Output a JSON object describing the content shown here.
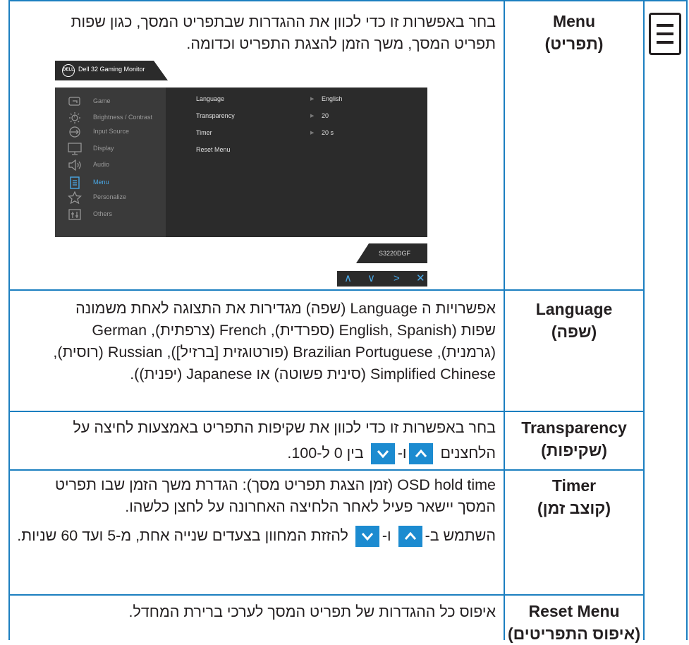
{
  "icon": "menu-icon",
  "accent_color": "#1c8bd0",
  "rows": {
    "menu": {
      "label_en": "Menu",
      "label_he": "(תפריט)",
      "desc": "בחר באפשרות זו כדי לכוון את ההגדרות שבתפריט המסך, כגון שפות תפריט המסך, משך הזמן להצגת התפריט וכדומה."
    },
    "language": {
      "label_en": "Language",
      "label_he": "(שפה)",
      "desc": "אפשרויות ה Language (שפה) מגדירות את התצוגה לאחת משמונה שפות (English, Spanish (ספרדית), French (צרפתית), German (גרמנית), Brazilian Portuguese (פורטוגזית [ברזיל]), Russian (רוסית), Simplified Chinese (סינית פשוטה) או Japanese (יפנית))."
    },
    "transparency": {
      "label_en": "Transparency",
      "label_he": "(שקיפות)",
      "desc_before": "בחר באפשרות זו כדי לכוון את שקיפות התפריט באמצעות לחיצה על הלחצנים",
      "desc_and": "ו-",
      "desc_after": "בין 0 ל-100."
    },
    "timer": {
      "label_en": "Timer",
      "label_he": "(קוצב זמן)",
      "desc1": "OSD hold time (זמן הצגת תפריט מסך): הגדרת משך הזמן שבו תפריט המסך יישאר פעיל לאחר הלחיצה האחרונה על לחצן כלשהו.",
      "desc2_before": "השתמש ב-",
      "desc2_and": "ו-",
      "desc2_after": "להזזת המחוון בצעדים שנייה אחת, מ-5 ועד 60 שניות."
    },
    "reset": {
      "label_en": "Reset Menu",
      "label_he": "(איפוס התפריטים)",
      "desc": "איפוס כל ההגדרות של תפריט המסך לערכי ברירת המחדל."
    }
  },
  "osd": {
    "logo": "DELL",
    "title": "Dell 32 Gaming Monitor",
    "sidebar": [
      {
        "label": "Game",
        "icon": "game-icon"
      },
      {
        "label": "Brightness / Contrast",
        "icon": "brightness-icon"
      },
      {
        "label": "Input Source",
        "icon": "input-source-icon"
      },
      {
        "label": "Display",
        "icon": "display-icon"
      },
      {
        "label": "Audio",
        "icon": "audio-icon"
      },
      {
        "label": "Menu",
        "icon": "menu-icon",
        "active": true
      },
      {
        "label": "Personalize",
        "icon": "star-icon"
      },
      {
        "label": "Others",
        "icon": "others-icon"
      }
    ],
    "options": [
      {
        "label": "Language",
        "value": "English"
      },
      {
        "label": "Transparency",
        "value": "20"
      },
      {
        "label": "Timer",
        "value": "20 s"
      },
      {
        "label": "Reset Menu",
        "value": ""
      }
    ],
    "model": "S3220DGF",
    "nav": [
      "∧",
      "∨",
      ">",
      "✕"
    ]
  }
}
